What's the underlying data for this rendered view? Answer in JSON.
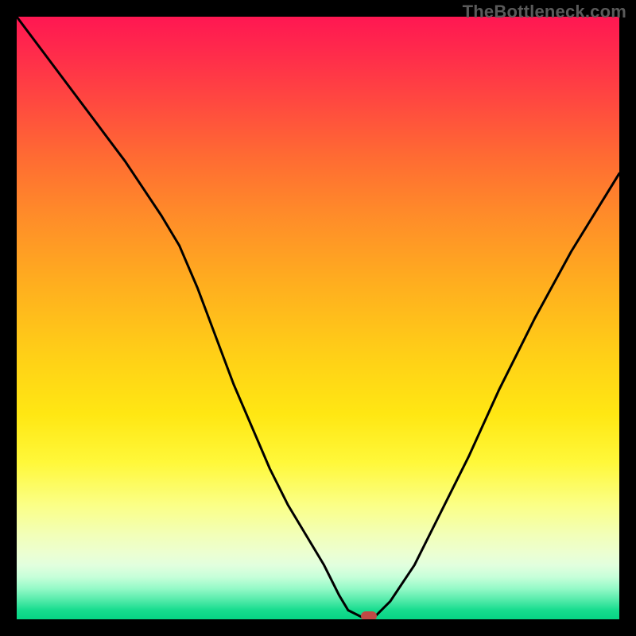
{
  "watermark": "TheBottleneck.com",
  "colors": {
    "frame_border": "#000000",
    "curve_stroke": "#000000",
    "marker_fill": "#bf4a45",
    "gradient_top": "#ff1752",
    "gradient_mid": "#ffe713",
    "gradient_bottom": "#06d484"
  },
  "chart_data": {
    "type": "line",
    "title": "",
    "xlabel": "",
    "ylabel": "",
    "xlim": [
      0,
      100
    ],
    "ylim": [
      0,
      100
    ],
    "grid": false,
    "series": [
      {
        "name": "bottleneck-curve",
        "x": [
          0,
          6,
          12,
          18,
          24,
          27,
          30,
          33,
          36,
          39,
          42,
          45,
          48,
          51,
          53.5,
          55,
          58,
          59,
          62,
          66,
          70,
          75,
          80,
          86,
          92,
          100
        ],
        "values": [
          100,
          92,
          84,
          76,
          67,
          62,
          55,
          47,
          39,
          32,
          25,
          19,
          14,
          9,
          4,
          1.5,
          0,
          0,
          3,
          9,
          17,
          27,
          38,
          50,
          61,
          74
        ]
      }
    ],
    "marker": {
      "x": 58.5,
      "y": 0.5,
      "shape": "rounded-rect",
      "color": "#bf4a45"
    },
    "background": "vertical-rainbow-gradient"
  }
}
